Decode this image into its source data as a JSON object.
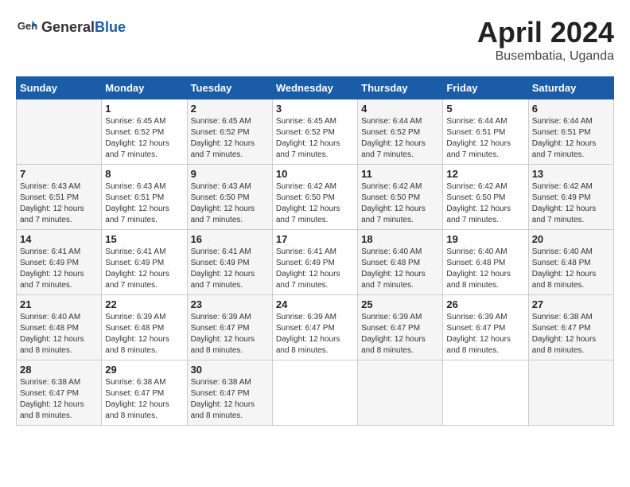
{
  "header": {
    "logo_general": "General",
    "logo_blue": "Blue",
    "month_title": "April 2024",
    "location": "Busembatia, Uganda"
  },
  "days_of_week": [
    "Sunday",
    "Monday",
    "Tuesday",
    "Wednesday",
    "Thursday",
    "Friday",
    "Saturday"
  ],
  "weeks": [
    [
      {
        "day": "",
        "sunrise": "",
        "sunset": "",
        "daylight": ""
      },
      {
        "day": "1",
        "sunrise": "Sunrise: 6:45 AM",
        "sunset": "Sunset: 6:52 PM",
        "daylight": "Daylight: 12 hours and 7 minutes."
      },
      {
        "day": "2",
        "sunrise": "Sunrise: 6:45 AM",
        "sunset": "Sunset: 6:52 PM",
        "daylight": "Daylight: 12 hours and 7 minutes."
      },
      {
        "day": "3",
        "sunrise": "Sunrise: 6:45 AM",
        "sunset": "Sunset: 6:52 PM",
        "daylight": "Daylight: 12 hours and 7 minutes."
      },
      {
        "day": "4",
        "sunrise": "Sunrise: 6:44 AM",
        "sunset": "Sunset: 6:52 PM",
        "daylight": "Daylight: 12 hours and 7 minutes."
      },
      {
        "day": "5",
        "sunrise": "Sunrise: 6:44 AM",
        "sunset": "Sunset: 6:51 PM",
        "daylight": "Daylight: 12 hours and 7 minutes."
      },
      {
        "day": "6",
        "sunrise": "Sunrise: 6:44 AM",
        "sunset": "Sunset: 6:51 PM",
        "daylight": "Daylight: 12 hours and 7 minutes."
      }
    ],
    [
      {
        "day": "7",
        "sunrise": "Sunrise: 6:43 AM",
        "sunset": "Sunset: 6:51 PM",
        "daylight": "Daylight: 12 hours and 7 minutes."
      },
      {
        "day": "8",
        "sunrise": "Sunrise: 6:43 AM",
        "sunset": "Sunset: 6:51 PM",
        "daylight": "Daylight: 12 hours and 7 minutes."
      },
      {
        "day": "9",
        "sunrise": "Sunrise: 6:43 AM",
        "sunset": "Sunset: 6:50 PM",
        "daylight": "Daylight: 12 hours and 7 minutes."
      },
      {
        "day": "10",
        "sunrise": "Sunrise: 6:42 AM",
        "sunset": "Sunset: 6:50 PM",
        "daylight": "Daylight: 12 hours and 7 minutes."
      },
      {
        "day": "11",
        "sunrise": "Sunrise: 6:42 AM",
        "sunset": "Sunset: 6:50 PM",
        "daylight": "Daylight: 12 hours and 7 minutes."
      },
      {
        "day": "12",
        "sunrise": "Sunrise: 6:42 AM",
        "sunset": "Sunset: 6:50 PM",
        "daylight": "Daylight: 12 hours and 7 minutes."
      },
      {
        "day": "13",
        "sunrise": "Sunrise: 6:42 AM",
        "sunset": "Sunset: 6:49 PM",
        "daylight": "Daylight: 12 hours and 7 minutes."
      }
    ],
    [
      {
        "day": "14",
        "sunrise": "Sunrise: 6:41 AM",
        "sunset": "Sunset: 6:49 PM",
        "daylight": "Daylight: 12 hours and 7 minutes."
      },
      {
        "day": "15",
        "sunrise": "Sunrise: 6:41 AM",
        "sunset": "Sunset: 6:49 PM",
        "daylight": "Daylight: 12 hours and 7 minutes."
      },
      {
        "day": "16",
        "sunrise": "Sunrise: 6:41 AM",
        "sunset": "Sunset: 6:49 PM",
        "daylight": "Daylight: 12 hours and 7 minutes."
      },
      {
        "day": "17",
        "sunrise": "Sunrise: 6:41 AM",
        "sunset": "Sunset: 6:49 PM",
        "daylight": "Daylight: 12 hours and 7 minutes."
      },
      {
        "day": "18",
        "sunrise": "Sunrise: 6:40 AM",
        "sunset": "Sunset: 6:48 PM",
        "daylight": "Daylight: 12 hours and 7 minutes."
      },
      {
        "day": "19",
        "sunrise": "Sunrise: 6:40 AM",
        "sunset": "Sunset: 6:48 PM",
        "daylight": "Daylight: 12 hours and 8 minutes."
      },
      {
        "day": "20",
        "sunrise": "Sunrise: 6:40 AM",
        "sunset": "Sunset: 6:48 PM",
        "daylight": "Daylight: 12 hours and 8 minutes."
      }
    ],
    [
      {
        "day": "21",
        "sunrise": "Sunrise: 6:40 AM",
        "sunset": "Sunset: 6:48 PM",
        "daylight": "Daylight: 12 hours and 8 minutes."
      },
      {
        "day": "22",
        "sunrise": "Sunrise: 6:39 AM",
        "sunset": "Sunset: 6:48 PM",
        "daylight": "Daylight: 12 hours and 8 minutes."
      },
      {
        "day": "23",
        "sunrise": "Sunrise: 6:39 AM",
        "sunset": "Sunset: 6:47 PM",
        "daylight": "Daylight: 12 hours and 8 minutes."
      },
      {
        "day": "24",
        "sunrise": "Sunrise: 6:39 AM",
        "sunset": "Sunset: 6:47 PM",
        "daylight": "Daylight: 12 hours and 8 minutes."
      },
      {
        "day": "25",
        "sunrise": "Sunrise: 6:39 AM",
        "sunset": "Sunset: 6:47 PM",
        "daylight": "Daylight: 12 hours and 8 minutes."
      },
      {
        "day": "26",
        "sunrise": "Sunrise: 6:39 AM",
        "sunset": "Sunset: 6:47 PM",
        "daylight": "Daylight: 12 hours and 8 minutes."
      },
      {
        "day": "27",
        "sunrise": "Sunrise: 6:38 AM",
        "sunset": "Sunset: 6:47 PM",
        "daylight": "Daylight: 12 hours and 8 minutes."
      }
    ],
    [
      {
        "day": "28",
        "sunrise": "Sunrise: 6:38 AM",
        "sunset": "Sunset: 6:47 PM",
        "daylight": "Daylight: 12 hours and 8 minutes."
      },
      {
        "day": "29",
        "sunrise": "Sunrise: 6:38 AM",
        "sunset": "Sunset: 6:47 PM",
        "daylight": "Daylight: 12 hours and 8 minutes."
      },
      {
        "day": "30",
        "sunrise": "Sunrise: 6:38 AM",
        "sunset": "Sunset: 6:47 PM",
        "daylight": "Daylight: 12 hours and 8 minutes."
      },
      {
        "day": "",
        "sunrise": "",
        "sunset": "",
        "daylight": ""
      },
      {
        "day": "",
        "sunrise": "",
        "sunset": "",
        "daylight": ""
      },
      {
        "day": "",
        "sunrise": "",
        "sunset": "",
        "daylight": ""
      },
      {
        "day": "",
        "sunrise": "",
        "sunset": "",
        "daylight": ""
      }
    ]
  ]
}
